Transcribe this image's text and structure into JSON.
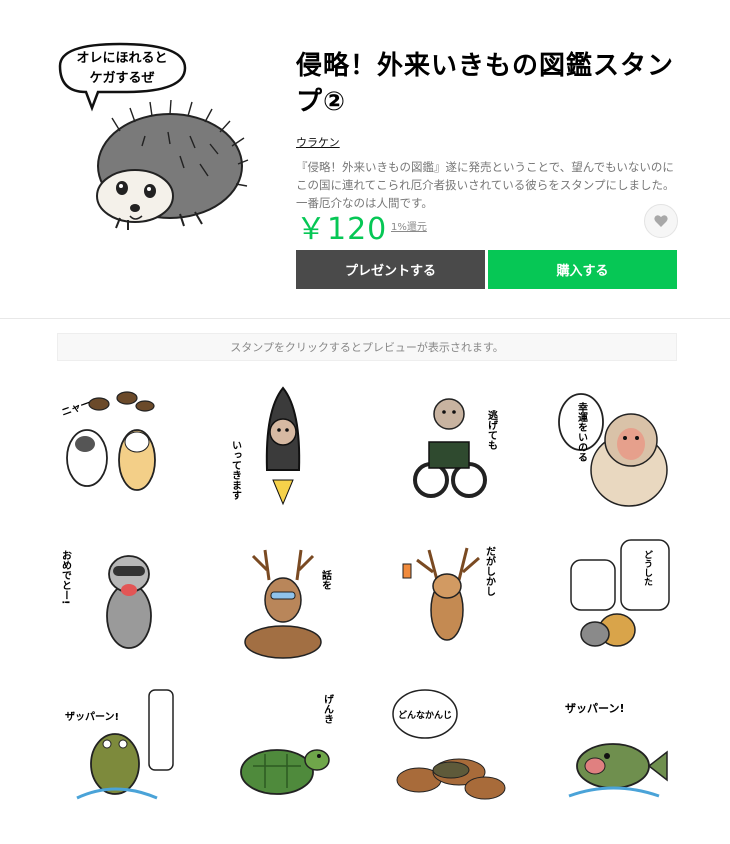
{
  "product": {
    "title": "侵略！外来いきもの図鑑スタンプ②",
    "author": "ウラケン",
    "description": "『侵略！外来いきもの図鑑』遂に発売ということで、望んでもいないのにこの国に連れてこられ厄介者扱いされている彼らをスタンプにしました。一番厄介なのは人間です。",
    "price": "￥120",
    "rebate": "1%還元",
    "main_sticker_text": [
      "オレにほれると",
      "ケガするぜ"
    ]
  },
  "buttons": {
    "present": "プレゼントする",
    "buy": "購入する"
  },
  "preview_hint": "スタンプをクリックするとプレビューが表示されます。",
  "stickers": [
    {
      "name": "sticker-cats-nyaa",
      "text": "ニャー"
    },
    {
      "name": "sticker-rocket-monkey",
      "text": "いってきます"
    },
    {
      "name": "sticker-bike-monkey",
      "text": "逃げても"
    },
    {
      "name": "sticker-monkey-luck",
      "text": "幸運をいのる"
    },
    {
      "name": "sticker-raccoon",
      "text": "おめでとー!"
    },
    {
      "name": "sticker-deer-talk",
      "text": "話を"
    },
    {
      "name": "sticker-deer-however",
      "text": "だがしかし"
    },
    {
      "name": "sticker-monkeys-dialog",
      "text": "どうした"
    },
    {
      "name": "sticker-frog-splash",
      "text": "ザッパーン!"
    },
    {
      "name": "sticker-turtle",
      "text": "げんき"
    },
    {
      "name": "sticker-toad-leaves",
      "text": "どんなかんじ"
    },
    {
      "name": "sticker-fish-splash",
      "text": "ザッパーン!"
    }
  ],
  "colors": {
    "accent": "#06c755",
    "present_button": "#4a4a4a"
  }
}
